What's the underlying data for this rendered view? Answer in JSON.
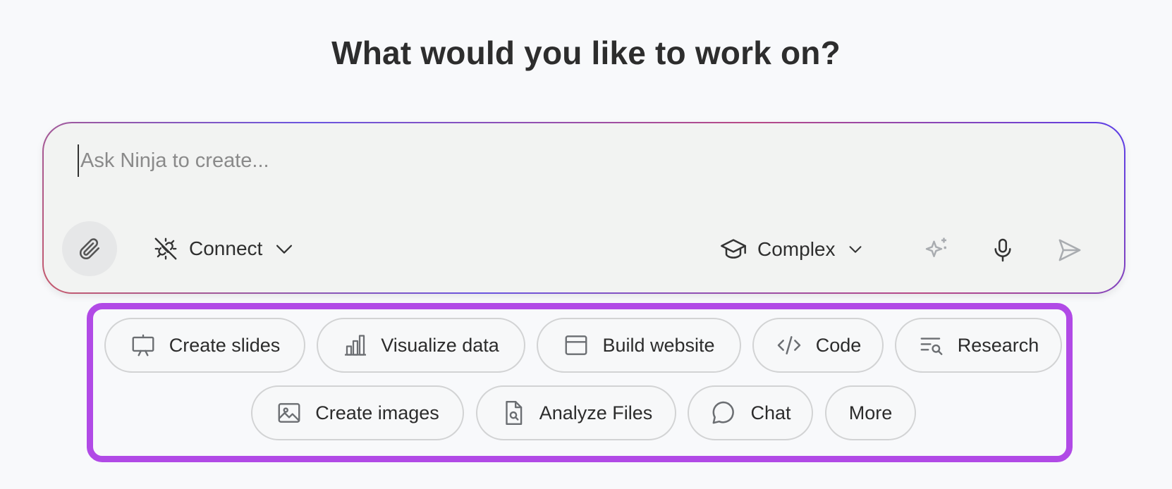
{
  "header": {
    "title": "What would you like to work on?"
  },
  "prompt": {
    "placeholder": "Ask Ninja to create...",
    "value": "",
    "connect_label": "Connect",
    "mode_label": "Complex"
  },
  "icons": {
    "attach": "paperclip-icon",
    "connect": "plug-disconnected-icon",
    "mode": "graduation-cap-icon",
    "enhance": "sparkle-icon",
    "voice": "microphone-icon",
    "send": "send-icon"
  },
  "colors": {
    "highlight_border": "#b14ae6",
    "gradient_start": "#c65a6c",
    "gradient_end": "#5b3ee8",
    "chip_border": "#d2d3d4"
  },
  "suggestions": {
    "row1": [
      {
        "label": "Create slides",
        "icon": "presentation-icon"
      },
      {
        "label": "Visualize data",
        "icon": "bar-chart-icon"
      },
      {
        "label": "Build website",
        "icon": "browser-window-icon"
      },
      {
        "label": "Code",
        "icon": "code-icon"
      },
      {
        "label": "Research",
        "icon": "search-list-icon"
      }
    ],
    "row2": [
      {
        "label": "Create images",
        "icon": "image-icon"
      },
      {
        "label": "Analyze Files",
        "icon": "file-search-icon"
      },
      {
        "label": "Chat",
        "icon": "chat-bubble-icon"
      },
      {
        "label": "More",
        "icon": ""
      }
    ]
  }
}
